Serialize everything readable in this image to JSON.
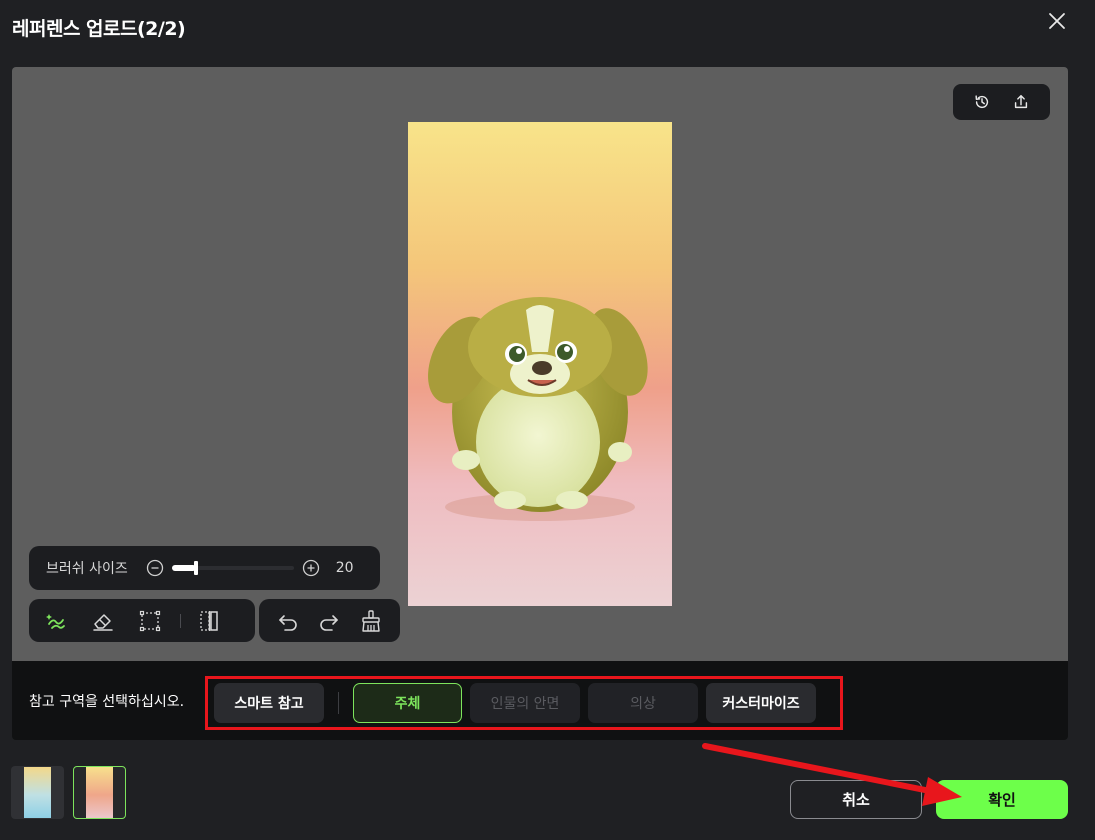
{
  "dialog": {
    "title": "레퍼렌스 업로드(2/2)",
    "close_icon": "close-icon"
  },
  "canvas": {
    "top_tools": [
      "history-icon",
      "upload-icon"
    ],
    "image_subject": "3D cartoon puppy"
  },
  "brush": {
    "label": "브러쉬 사이즈",
    "value": "20",
    "level_fraction": 0.2,
    "minus_icon": "minus-circle-icon",
    "plus_icon": "plus-circle-icon"
  },
  "tools": {
    "left": [
      "smart-brush-icon",
      "eraser-icon",
      "selection-box-icon",
      "mirror-icon"
    ],
    "right": [
      "undo-icon",
      "redo-icon",
      "clear-brush-icon"
    ]
  },
  "region": {
    "prompt": "참고 구역을 선택하십시오.",
    "options": {
      "smart": "스마트 참고",
      "subject": "주체",
      "face": "인물의 안면",
      "outfit": "의상",
      "custom": "커스터마이즈"
    },
    "selected": "주체"
  },
  "thumbnails": {
    "selected_index": 1
  },
  "actions": {
    "cancel_label": "취소",
    "confirm_label": "확인"
  },
  "colors": {
    "accent": "#7de45c",
    "confirm": "#6dff4a",
    "highlight_box": "#e8161c",
    "background": "#1f2023",
    "canvas": "#5e5e5e"
  }
}
